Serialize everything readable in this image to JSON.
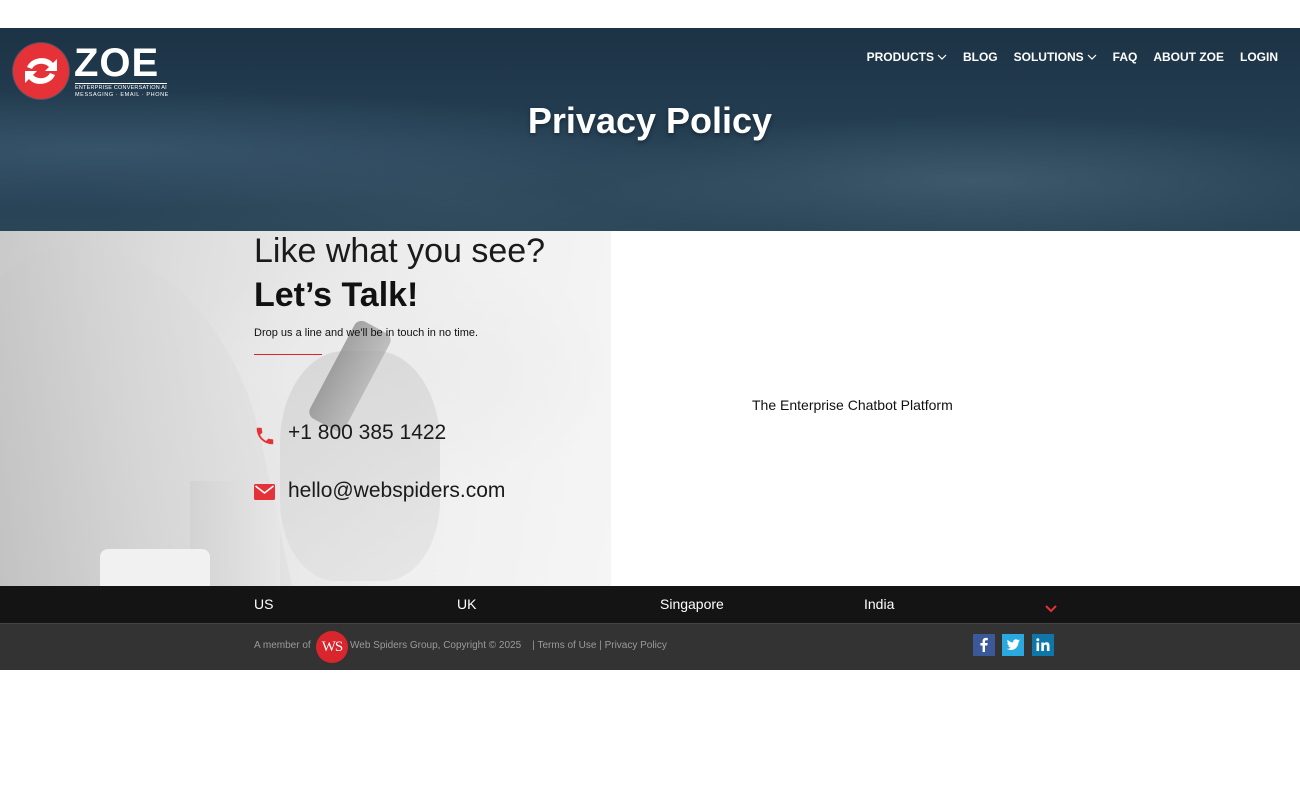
{
  "header": {
    "logo": {
      "wordmark": "ZOE",
      "tagline": "ENTERPRISE CONVERSATION AI",
      "channels": "MESSAGING · EMAIL · PHONE"
    },
    "nav": [
      {
        "label": "PRODUCTS",
        "has_dropdown": true
      },
      {
        "label": "BLOG",
        "has_dropdown": false
      },
      {
        "label": "SOLUTIONS",
        "has_dropdown": true
      },
      {
        "label": "FAQ",
        "has_dropdown": false
      },
      {
        "label": "ABOUT ZOE",
        "has_dropdown": false
      },
      {
        "label": "LOGIN",
        "has_dropdown": false
      }
    ],
    "page_title": "Privacy Policy"
  },
  "contact": {
    "heading_light": "Like what you see?",
    "heading_bold": "Let’s Talk!",
    "subtext": "Drop us a line and we'll be in touch in no time.",
    "phone": "+1 800 385 1422",
    "email": "hello@webspiders.com",
    "icons": {
      "phone": "phone-icon",
      "email": "mail-icon"
    }
  },
  "aside": {
    "tagline": "The Enterprise Chatbot Platform"
  },
  "footer": {
    "offices": [
      "US",
      "UK",
      "Singapore",
      "India"
    ],
    "member_prefix": "A member of",
    "ws_badge": "WS",
    "copyright": "Web Spiders Group, Copyright © 2025",
    "links": {
      "terms": "Terms of Use",
      "privacy": "Privacy Policy"
    },
    "social": [
      "facebook-icon",
      "twitter-icon",
      "linkedin-icon"
    ]
  },
  "colors": {
    "accent_red": "#d8262c",
    "hero_navy": "#1c3345",
    "footer_dark": "#141414",
    "footer_bar": "#333333"
  }
}
